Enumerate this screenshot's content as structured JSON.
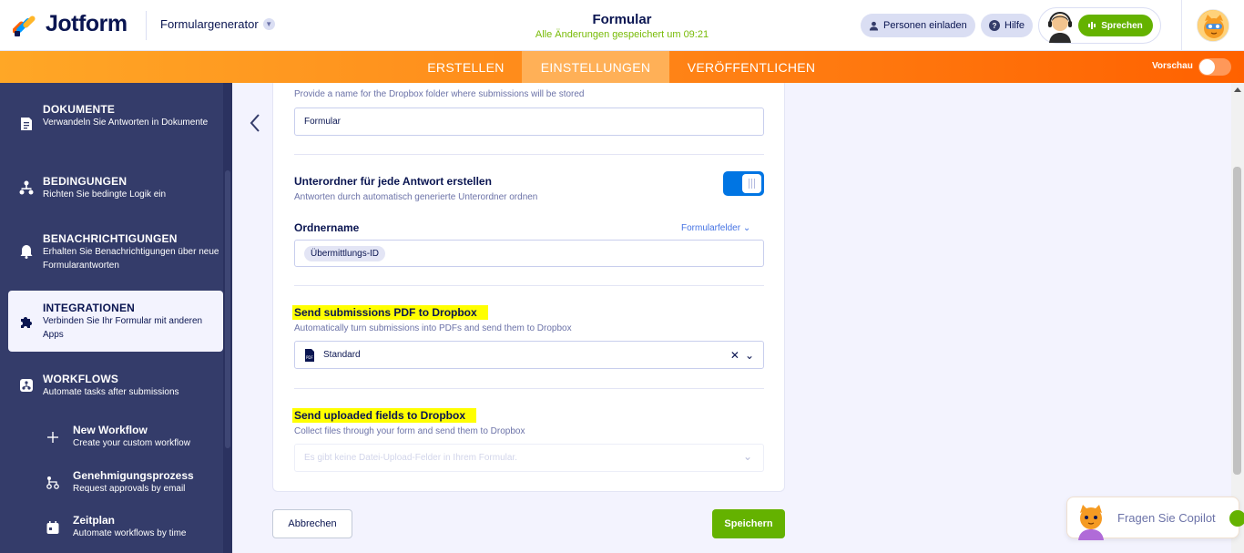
{
  "header": {
    "brand": "Jotform",
    "generator": "Formulargenerator",
    "form_title": "Formular",
    "saved_status": "Alle Änderungen gespeichert um 09:21",
    "invite_label": "Personen einladen",
    "help_label": "Hilfe",
    "speak_label": "Sprechen"
  },
  "nav": {
    "tabs": [
      "ERSTELLEN",
      "EINSTELLUNGEN",
      "VERÖFFENTLICHEN"
    ],
    "active_tab": "EINSTELLUNGEN",
    "preview_label": "Vorschau"
  },
  "sidebar": {
    "items": [
      {
        "title": "DOKUMENTE",
        "subtitle": "Verwandeln Sie Antworten in Dokumente"
      },
      {
        "title": "BEDINGUNGEN",
        "subtitle": "Richten Sie bedingte Logik ein"
      },
      {
        "title": "BENACHRICHTIGUNGEN",
        "subtitle": "Erhalten Sie Benachrichtigungen über neue Formularantworten"
      },
      {
        "title": "INTEGRATIONEN",
        "subtitle": "Verbinden Sie Ihr Formular mit anderen Apps"
      },
      {
        "title": "WORKFLOWS",
        "subtitle": "Automate tasks after submissions"
      }
    ],
    "workflow_items": [
      {
        "title": "New Workflow",
        "subtitle": "Create your custom workflow"
      },
      {
        "title": "Genehmigungsprozess",
        "subtitle": "Request approvals by email"
      },
      {
        "title": "Zeitplan",
        "subtitle": "Automate workflows by time"
      }
    ]
  },
  "settings": {
    "folder_desc": "Provide a name for the Dropbox folder where submissions will be stored",
    "folder_value": "Formular",
    "subfolder_title": "Unterordner für jede Antwort erstellen",
    "subfolder_desc": "Antworten durch automatisch generierte Unterordner ordnen",
    "subfolder_enabled": true,
    "ordnername_label": "Ordnername",
    "form_fields_link": "Formularfelder",
    "ordnername_chip": "Übermittlungs-ID",
    "pdf_title": "Send submissions PDF to Dropbox",
    "pdf_desc": "Automatically turn submissions into PDFs and send them to Dropbox",
    "pdf_select_value": "Standard",
    "pdf_icon_text": "PDF",
    "uploads_title": "Send uploaded fields to Dropbox",
    "uploads_desc": "Collect files through your form and send them to Dropbox",
    "uploads_placeholder": "Es gibt keine Datei-Upload-Felder in Ihrem Formular."
  },
  "actions": {
    "cancel": "Abbrechen",
    "save": "Speichern"
  },
  "copilot": {
    "label": "Fragen Sie Copilot"
  },
  "colors": {
    "navy": "#0a1551",
    "sidebar": "#343c6a",
    "accent_green": "#64b200",
    "toggle_blue": "#0075e3",
    "highlight": "#ffff00"
  }
}
